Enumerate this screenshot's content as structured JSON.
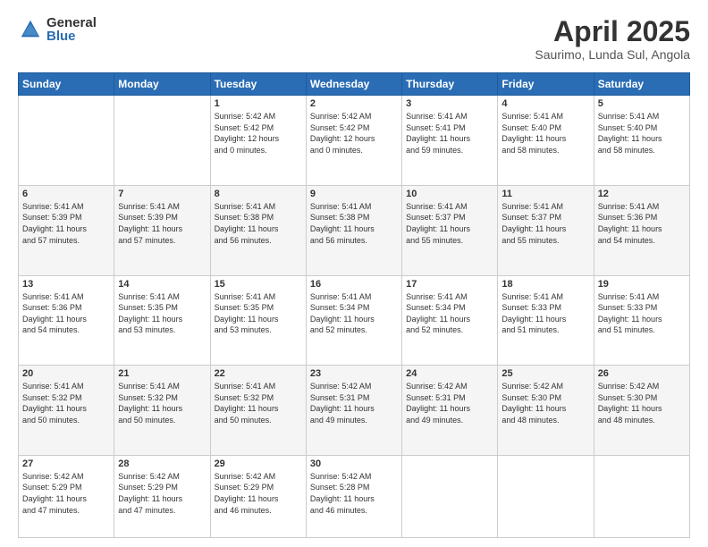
{
  "header": {
    "logo_general": "General",
    "logo_blue": "Blue",
    "title": "April 2025",
    "subtitle": "Saurimo, Lunda Sul, Angola"
  },
  "days": [
    "Sunday",
    "Monday",
    "Tuesday",
    "Wednesday",
    "Thursday",
    "Friday",
    "Saturday"
  ],
  "weeks": [
    [
      {
        "num": "",
        "text": ""
      },
      {
        "num": "",
        "text": ""
      },
      {
        "num": "1",
        "text": "Sunrise: 5:42 AM\nSunset: 5:42 PM\nDaylight: 12 hours\nand 0 minutes."
      },
      {
        "num": "2",
        "text": "Sunrise: 5:42 AM\nSunset: 5:42 PM\nDaylight: 12 hours\nand 0 minutes."
      },
      {
        "num": "3",
        "text": "Sunrise: 5:41 AM\nSunset: 5:41 PM\nDaylight: 11 hours\nand 59 minutes."
      },
      {
        "num": "4",
        "text": "Sunrise: 5:41 AM\nSunset: 5:40 PM\nDaylight: 11 hours\nand 58 minutes."
      },
      {
        "num": "5",
        "text": "Sunrise: 5:41 AM\nSunset: 5:40 PM\nDaylight: 11 hours\nand 58 minutes."
      }
    ],
    [
      {
        "num": "6",
        "text": "Sunrise: 5:41 AM\nSunset: 5:39 PM\nDaylight: 11 hours\nand 57 minutes."
      },
      {
        "num": "7",
        "text": "Sunrise: 5:41 AM\nSunset: 5:39 PM\nDaylight: 11 hours\nand 57 minutes."
      },
      {
        "num": "8",
        "text": "Sunrise: 5:41 AM\nSunset: 5:38 PM\nDaylight: 11 hours\nand 56 minutes."
      },
      {
        "num": "9",
        "text": "Sunrise: 5:41 AM\nSunset: 5:38 PM\nDaylight: 11 hours\nand 56 minutes."
      },
      {
        "num": "10",
        "text": "Sunrise: 5:41 AM\nSunset: 5:37 PM\nDaylight: 11 hours\nand 55 minutes."
      },
      {
        "num": "11",
        "text": "Sunrise: 5:41 AM\nSunset: 5:37 PM\nDaylight: 11 hours\nand 55 minutes."
      },
      {
        "num": "12",
        "text": "Sunrise: 5:41 AM\nSunset: 5:36 PM\nDaylight: 11 hours\nand 54 minutes."
      }
    ],
    [
      {
        "num": "13",
        "text": "Sunrise: 5:41 AM\nSunset: 5:36 PM\nDaylight: 11 hours\nand 54 minutes."
      },
      {
        "num": "14",
        "text": "Sunrise: 5:41 AM\nSunset: 5:35 PM\nDaylight: 11 hours\nand 53 minutes."
      },
      {
        "num": "15",
        "text": "Sunrise: 5:41 AM\nSunset: 5:35 PM\nDaylight: 11 hours\nand 53 minutes."
      },
      {
        "num": "16",
        "text": "Sunrise: 5:41 AM\nSunset: 5:34 PM\nDaylight: 11 hours\nand 52 minutes."
      },
      {
        "num": "17",
        "text": "Sunrise: 5:41 AM\nSunset: 5:34 PM\nDaylight: 11 hours\nand 52 minutes."
      },
      {
        "num": "18",
        "text": "Sunrise: 5:41 AM\nSunset: 5:33 PM\nDaylight: 11 hours\nand 51 minutes."
      },
      {
        "num": "19",
        "text": "Sunrise: 5:41 AM\nSunset: 5:33 PM\nDaylight: 11 hours\nand 51 minutes."
      }
    ],
    [
      {
        "num": "20",
        "text": "Sunrise: 5:41 AM\nSunset: 5:32 PM\nDaylight: 11 hours\nand 50 minutes."
      },
      {
        "num": "21",
        "text": "Sunrise: 5:41 AM\nSunset: 5:32 PM\nDaylight: 11 hours\nand 50 minutes."
      },
      {
        "num": "22",
        "text": "Sunrise: 5:41 AM\nSunset: 5:32 PM\nDaylight: 11 hours\nand 50 minutes."
      },
      {
        "num": "23",
        "text": "Sunrise: 5:42 AM\nSunset: 5:31 PM\nDaylight: 11 hours\nand 49 minutes."
      },
      {
        "num": "24",
        "text": "Sunrise: 5:42 AM\nSunset: 5:31 PM\nDaylight: 11 hours\nand 49 minutes."
      },
      {
        "num": "25",
        "text": "Sunrise: 5:42 AM\nSunset: 5:30 PM\nDaylight: 11 hours\nand 48 minutes."
      },
      {
        "num": "26",
        "text": "Sunrise: 5:42 AM\nSunset: 5:30 PM\nDaylight: 11 hours\nand 48 minutes."
      }
    ],
    [
      {
        "num": "27",
        "text": "Sunrise: 5:42 AM\nSunset: 5:29 PM\nDaylight: 11 hours\nand 47 minutes."
      },
      {
        "num": "28",
        "text": "Sunrise: 5:42 AM\nSunset: 5:29 PM\nDaylight: 11 hours\nand 47 minutes."
      },
      {
        "num": "29",
        "text": "Sunrise: 5:42 AM\nSunset: 5:29 PM\nDaylight: 11 hours\nand 46 minutes."
      },
      {
        "num": "30",
        "text": "Sunrise: 5:42 AM\nSunset: 5:28 PM\nDaylight: 11 hours\nand 46 minutes."
      },
      {
        "num": "",
        "text": ""
      },
      {
        "num": "",
        "text": ""
      },
      {
        "num": "",
        "text": ""
      }
    ]
  ]
}
